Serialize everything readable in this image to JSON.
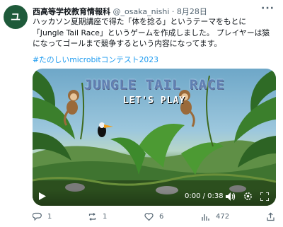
{
  "author": {
    "avatar_text": "ユ",
    "name": "西高等学校教育情報科",
    "handle": "@_osaka_nishi",
    "separator": "·",
    "date": "8月28日"
  },
  "more_label": "···",
  "tweet": {
    "text": "ハッカソン夏期講座で得た「体を捻る」というテーマをもとに「Jungle Tail Race」というゲームを作成しました。 プレイヤーは猿になってゴールまで競争するという内容になってます。",
    "hashtag": "#たのしいmicrobitコンテスト2023"
  },
  "video": {
    "title": "JUNGLE TAIL RACE",
    "subtitle": "LET'S PLAY",
    "time": "0:00 / 0:38",
    "icons": {
      "play": "play-icon",
      "volume": "volume-icon",
      "settings": "settings-icon",
      "fullscreen": "fullscreen-icon"
    }
  },
  "actions": {
    "reply_count": "1",
    "retweet_count": "1",
    "like_count": "6",
    "views_count": "472",
    "icons": [
      "reply-icon",
      "retweet-icon",
      "like-icon",
      "views-icon",
      "share-icon"
    ]
  },
  "colors": {
    "link": "#1d9bf0",
    "secondary_text": "#536471",
    "avatar_bg": "#1e5a3a"
  }
}
